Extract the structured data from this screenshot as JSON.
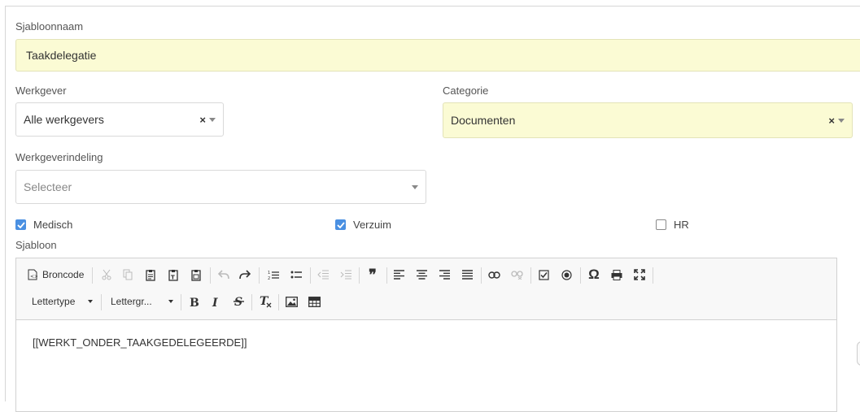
{
  "template_name": {
    "label": "Sjabloonnaam",
    "value": "Taakdelegatie"
  },
  "employer": {
    "label": "Werkgever",
    "value": "Alle werkgevers",
    "clear": "×"
  },
  "category": {
    "label": "Categorie",
    "value": "Documenten",
    "clear": "×"
  },
  "division": {
    "label": "Werkgeverindeling",
    "placeholder": "Selecteer"
  },
  "checkboxes": [
    {
      "label": "Medisch",
      "checked": true
    },
    {
      "label": "Verzuim",
      "checked": true
    },
    {
      "label": "HR",
      "checked": false
    }
  ],
  "template": {
    "label": "Sjabloon",
    "toolbar": {
      "source_label": "Broncode",
      "font_label": "Lettertype",
      "size_label": "Lettergr...",
      "blockquote_glyph": "❞",
      "special_char_glyph": "Ω"
    },
    "content": "[[WERKT_ONDER_TAAKGEDELEGEERDE]]"
  },
  "colors": {
    "required_field_bg": "#fbfbd4",
    "checkbox_on": "#4a90e2"
  }
}
